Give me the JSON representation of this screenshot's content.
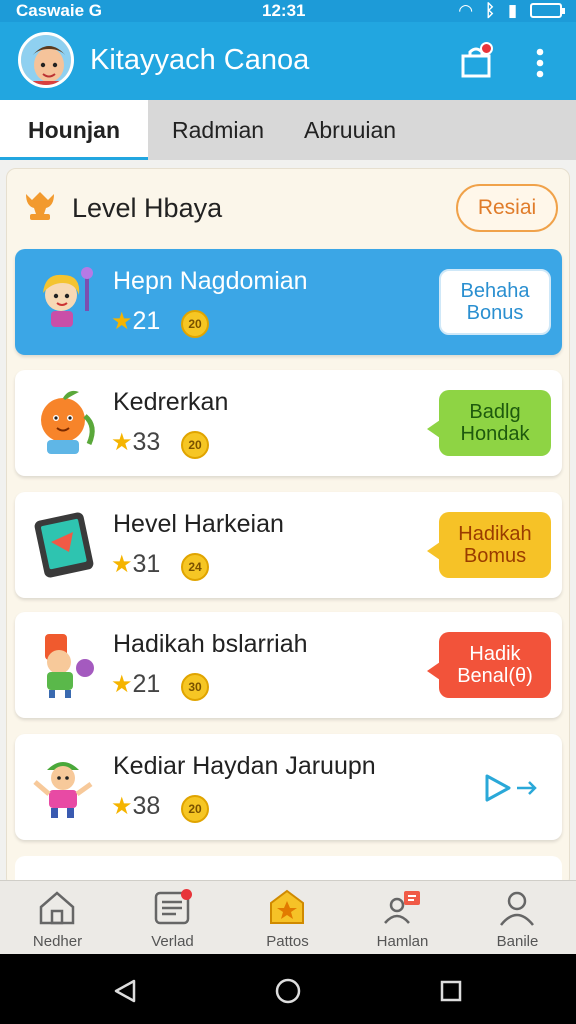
{
  "status_bar": {
    "left": "Caswaie G",
    "time": "12:31"
  },
  "app": {
    "title": "Kitayyach Canoa"
  },
  "tabs": [
    {
      "label": "Hounjan",
      "active": true
    },
    {
      "label": "Radmian",
      "active": false
    },
    {
      "label": "Abruuian",
      "active": false
    }
  ],
  "section": {
    "title": "Level Hbaya",
    "reset_label": "Resiai"
  },
  "levels": [
    {
      "name": "Hepn Nagdomian",
      "stars": "21",
      "coin": "20",
      "bonus": "Behaha Bonus",
      "bonus_style": "white"
    },
    {
      "name": "Kedrerkan",
      "stars": "33",
      "coin": "20",
      "bonus": "Badlg Hondak",
      "bonus_style": "green"
    },
    {
      "name": "Hevel Harkeian",
      "stars": "31",
      "coin": "24",
      "bonus": "Hadikah Bomus",
      "bonus_style": "yellow"
    },
    {
      "name": "Hadikah bslarriah",
      "stars": "21",
      "coin": "30",
      "bonus": "Hadik Benal(θ)",
      "bonus_style": "red"
    },
    {
      "name": "Kediar Haydan Jaruupn",
      "stars": "38",
      "coin": "20",
      "bonus": "",
      "bonus_style": "play"
    }
  ],
  "bottom_nav": [
    {
      "label": "Nedher",
      "icon": "home-icon"
    },
    {
      "label": "Verlad",
      "icon": "list-icon"
    },
    {
      "label": "Pattos",
      "icon": "star-badge-icon"
    },
    {
      "label": "Hamlan",
      "icon": "group-icon"
    },
    {
      "label": "Banile",
      "icon": "profile-icon"
    }
  ],
  "colors": {
    "primary": "#22a6e0",
    "accent": "#f0a24a",
    "highlight_card": "#3ba6e6"
  }
}
